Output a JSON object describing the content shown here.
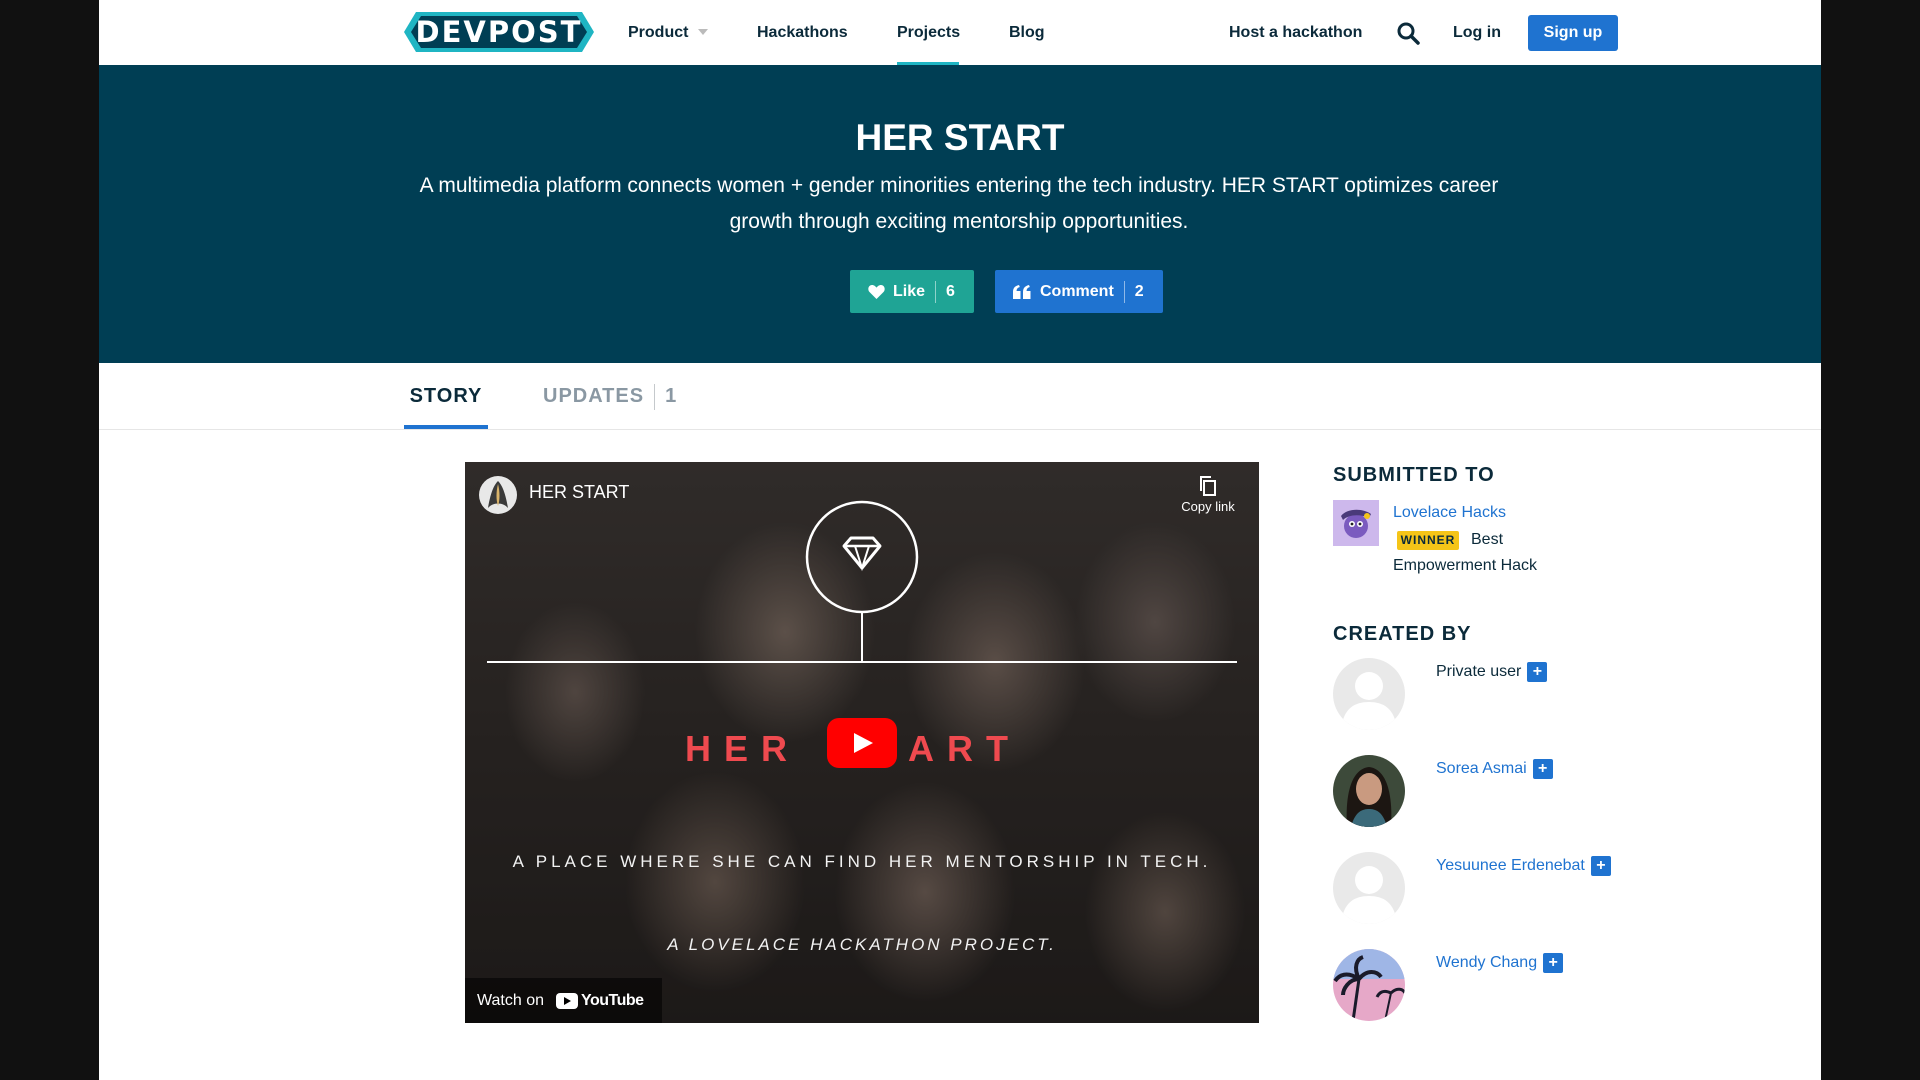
{
  "nav": {
    "logo": "DEVPOST",
    "items": [
      "Product",
      "Hackathons",
      "Projects",
      "Blog"
    ],
    "host": "Host a hackathon",
    "login": "Log in",
    "signup": "Sign up"
  },
  "hero": {
    "title": "HER START",
    "description": "A multimedia platform connects women + gender minorities entering the tech industry. HER START optimizes career growth through exciting mentorship opportunities.",
    "like_label": "Like",
    "like_count": "6",
    "comment_label": "Comment",
    "comment_count": "2"
  },
  "tabs": {
    "story": "STORY",
    "updates": "UPDATES",
    "updates_count": "1"
  },
  "video": {
    "title": "HER START",
    "copy_link": "Copy link",
    "her_left": "HER",
    "her_right": "ART",
    "tagline": "A PLACE WHERE SHE CAN FIND HER MENTORSHIP IN TECH.",
    "subtagline": "A LOVELACE HACKATHON PROJECT.",
    "watch_on": "Watch on",
    "youtube": "YouTube"
  },
  "sidebar": {
    "submitted_heading": "SUBMITTED TO",
    "hackathon": "Lovelace Hacks",
    "winner_badge": "WINNER",
    "prize_line1": "Best",
    "prize_line2": "Empowerment Hack",
    "created_heading": "CREATED BY",
    "members": [
      {
        "name": "Private user"
      },
      {
        "name": "Sorea Asmai"
      },
      {
        "name": "Yesuunee Erdenebat"
      },
      {
        "name": "Wendy Chang"
      }
    ]
  },
  "colors": {
    "hero_bg": "#003e54",
    "link": "#1f73d0",
    "like": "#1fa495",
    "accent": "#1fb5c3",
    "winner": "#f5c518"
  }
}
